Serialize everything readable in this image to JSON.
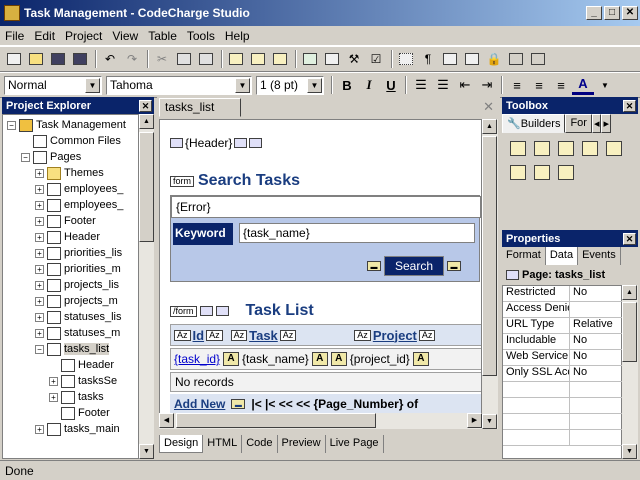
{
  "window": {
    "title": "Task Management - CodeCharge Studio",
    "min": "_",
    "max": "□",
    "close": "✕"
  },
  "menu": [
    "File",
    "Edit",
    "Project",
    "View",
    "Table",
    "Tools",
    "Help"
  ],
  "format_bar": {
    "style": "Normal",
    "font": "Tahoma",
    "size": "1 (8 pt)",
    "bold": "B",
    "italic": "I",
    "underline": "U",
    "fontcolor": "A"
  },
  "project_explorer": {
    "title": "Project Explorer",
    "items": [
      {
        "label": "Task Management",
        "level": 0,
        "expander": "−"
      },
      {
        "label": "Common Files",
        "level": 1,
        "expander": ""
      },
      {
        "label": "Pages",
        "level": 1,
        "expander": "−"
      },
      {
        "label": "Themes",
        "level": 2,
        "expander": "+"
      },
      {
        "label": "employees_",
        "level": 2,
        "expander": "+"
      },
      {
        "label": "employees_",
        "level": 2,
        "expander": "+"
      },
      {
        "label": "Footer",
        "level": 2,
        "expander": "+"
      },
      {
        "label": "Header",
        "level": 2,
        "expander": "+"
      },
      {
        "label": "priorities_lis",
        "level": 2,
        "expander": "+"
      },
      {
        "label": "priorities_m",
        "level": 2,
        "expander": "+"
      },
      {
        "label": "projects_lis",
        "level": 2,
        "expander": "+"
      },
      {
        "label": "projects_m",
        "level": 2,
        "expander": "+"
      },
      {
        "label": "statuses_lis",
        "level": 2,
        "expander": "+"
      },
      {
        "label": "statuses_m",
        "level": 2,
        "expander": "+"
      },
      {
        "label": "tasks_list",
        "level": 2,
        "expander": "−"
      },
      {
        "label": "Header",
        "level": 3,
        "expander": ""
      },
      {
        "label": "tasksSe",
        "level": 3,
        "expander": "+"
      },
      {
        "label": "tasks",
        "level": 3,
        "expander": "+"
      },
      {
        "label": "Footer",
        "level": 3,
        "expander": ""
      },
      {
        "label": "tasks_main",
        "level": 2,
        "expander": "+"
      }
    ]
  },
  "designer": {
    "tab": "tasks_list",
    "close": "✕",
    "header_tag": "{Header}",
    "form_tag": "form",
    "endform_tag": "/form",
    "search_title": "Search Tasks",
    "error_text": "{Error}",
    "keyword_label": "Keyword",
    "keyword_value": "{task_name}",
    "search_button": "Search",
    "list_title": "Task List",
    "columns": [
      "Id",
      "Task",
      "Project"
    ],
    "row_cells": [
      "{task_id}",
      "{task_name}",
      "{project_id}"
    ],
    "no_records": "No records",
    "add_new": "Add New",
    "nav_text": "|< |< << << {Page_Number} of",
    "sort_icon": "Az",
    "bottom_tabs": [
      "Design",
      "HTML",
      "Code",
      "Preview",
      "Live Page"
    ]
  },
  "toolbox": {
    "title": "Toolbox",
    "tabs": [
      "Builders",
      "For"
    ]
  },
  "properties": {
    "title": "Properties",
    "tabs": [
      "Format",
      "Data",
      "Events"
    ],
    "object_title": "Page: tasks_list",
    "rows": [
      {
        "key": "Restricted",
        "value": "No"
      },
      {
        "key": "Access Denie",
        "value": ""
      },
      {
        "key": "URL Type",
        "value": "Relative"
      },
      {
        "key": "Includable",
        "value": "No"
      },
      {
        "key": "Web Service",
        "value": "No"
      },
      {
        "key": "Only SSL Acc",
        "value": "No"
      }
    ]
  },
  "status": "Done"
}
